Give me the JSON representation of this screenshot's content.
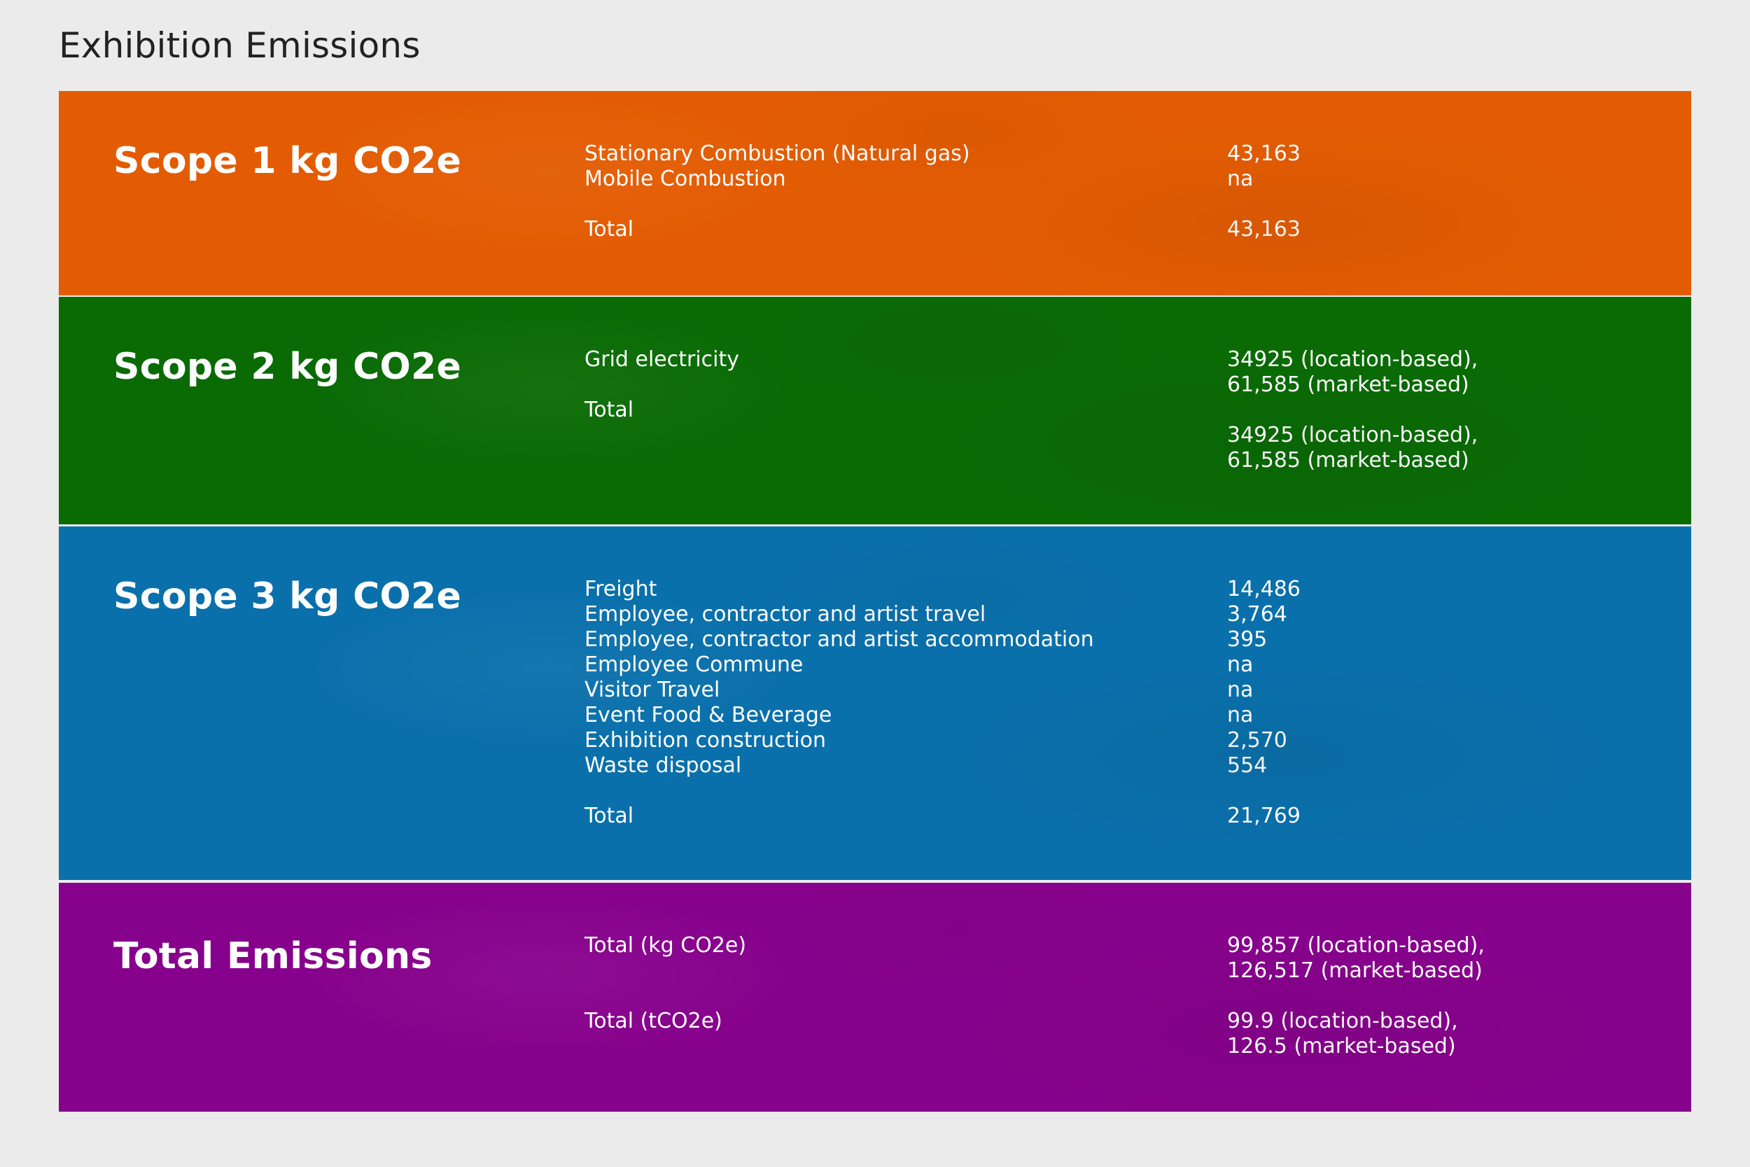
{
  "page": {
    "title": "Exhibition Emissions"
  },
  "colors": {
    "background": "#ecebeb",
    "scope1": "#e35c03",
    "scope2": "#0a6b05",
    "scope3": "#0a70ab",
    "total": "#87028c"
  },
  "scope1": {
    "heading": "Scope 1 kg CO2e",
    "rows": [
      {
        "label": "Stationary Combustion (Natural gas)",
        "value": "43,163"
      },
      {
        "label": "Mobile Combustion",
        "value": "na"
      },
      {
        "label": "Total",
        "value": "43,163"
      }
    ]
  },
  "scope2": {
    "heading": "Scope 2 kg CO2e",
    "rows": [
      {
        "label": "Grid electricity",
        "value_line1": "34925 (location-based),",
        "value_line2": "61,585 (market-based)"
      },
      {
        "label": "Total",
        "value_line1": "34925 (location-based),",
        "value_line2": "61,585 (market-based)"
      }
    ]
  },
  "scope3": {
    "heading": "Scope 3 kg CO2e",
    "rows": [
      {
        "label": "Freight",
        "value": "14,486"
      },
      {
        "label": "Employee, contractor and artist travel",
        "value": "3,764"
      },
      {
        "label": "Employee, contractor and artist accommodation",
        "value": "395"
      },
      {
        "label": "Employee Commune",
        "value": "na"
      },
      {
        "label": "Visitor Travel",
        "value": "na"
      },
      {
        "label": "Event Food & Beverage",
        "value": "na"
      },
      {
        "label": "Exhibition construction",
        "value": "2,570"
      },
      {
        "label": "Waste disposal",
        "value": "554"
      },
      {
        "label": "Total",
        "value": "21,769"
      }
    ]
  },
  "total": {
    "heading": "Total Emissions",
    "rows": [
      {
        "label": "Total (kg CO2e)",
        "value_line1": "99,857 (location-based),",
        "value_line2": "126,517 (market-based)"
      },
      {
        "label": "Total (tCO2e)",
        "value_line1": "99.9 (location-based),",
        "value_line2": "126.5 (market-based)"
      }
    ]
  }
}
